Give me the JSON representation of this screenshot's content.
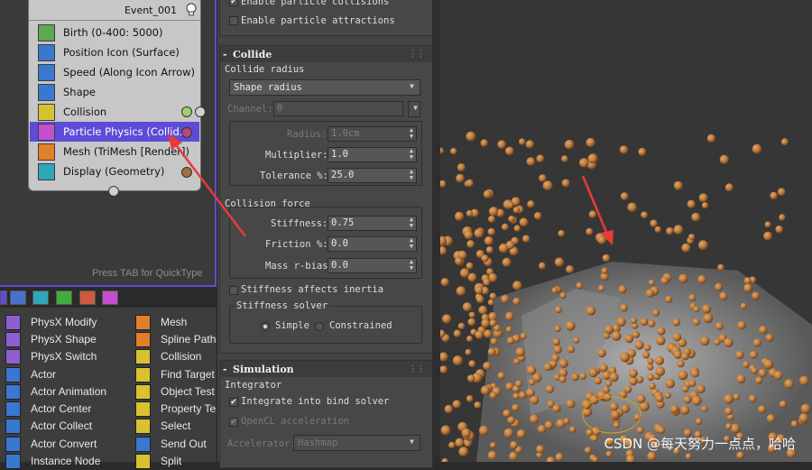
{
  "particle_view": {
    "event_title": "Event_001",
    "operators": [
      {
        "label": "Birth (0-400: 5000)",
        "color": "#5fa84e"
      },
      {
        "label": "Position Icon (Surface)",
        "color": "#3a78d0"
      },
      {
        "label": "Speed (Along Icon Arrow)",
        "color": "#3a78d0"
      },
      {
        "label": "Shape",
        "color": "#3a78d0"
      },
      {
        "label": "Collision",
        "color": "#d9c230"
      },
      {
        "label": "Particle Physics (Collid...",
        "color": "#c64fd0"
      },
      {
        "label": "Mesh (TriMesh [Render])",
        "color": "#e0802a"
      },
      {
        "label": "Display (Geometry)",
        "color": "#2fa7b8"
      }
    ],
    "quicktype_hint": "Press TAB for QuickType"
  },
  "depot": {
    "col1": [
      "PhysX Modify",
      "PhysX Shape",
      "PhysX Switch",
      "Actor",
      "Actor Animation",
      "Actor Center",
      "Actor Collect",
      "Actor Convert",
      "Instance Node"
    ],
    "col2": [
      "Mesh",
      "Spline Paths",
      "Collision",
      "Find Target",
      "Object Test",
      "Property Tes",
      "Select",
      "Send Out",
      "Split"
    ]
  },
  "params": {
    "top": {
      "enable_collisions": "Enable particle collisions",
      "enable_attractions": "Enable particle attractions"
    },
    "collide": {
      "title": "Collide",
      "collide_radius_label": "Collide radius",
      "radius_type": "Shape radius",
      "channel_label": "Channel:",
      "channel_value": "0",
      "radius_label": "Radius:",
      "radius_value": "1.0cm",
      "multiplier_label": "Multiplier:",
      "multiplier_value": "1.0",
      "tolerance_label": "Tolerance %:",
      "tolerance_value": "25.0",
      "collision_force_label": "Collision force",
      "stiffness_label": "Stiffness:",
      "stiffness_value": "0.75",
      "friction_label": "Friction %:",
      "friction_value": "0.0",
      "mass_label": "Mass r-bias:",
      "mass_value": "0.0",
      "stiffness_inertia": "Stiffness affects inertia",
      "stiffness_solver_label": "Stiffness solver",
      "solver_simple": "Simple",
      "solver_constrained": "Constrained"
    },
    "simulation": {
      "title": "Simulation",
      "integrator_label": "Integrator",
      "integrate_bind": "Integrate into bind solver",
      "opencl": "OpenCL acceleration",
      "accelerator_label": "Accelerator:",
      "accelerator_value": "Hashmap"
    }
  },
  "viewport": {
    "watermark": "CSDN @每天努力一点点，哈哈",
    "particle_color": "#b8783c"
  }
}
